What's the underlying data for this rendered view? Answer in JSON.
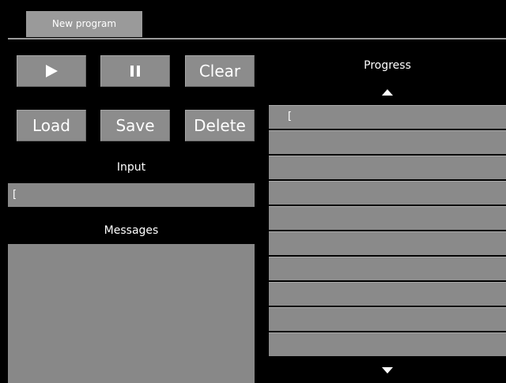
{
  "tab": {
    "label": "New program"
  },
  "buttons": {
    "play_icon": "play-icon",
    "pause_icon": "pause-icon",
    "clear": "Clear",
    "load": "Load",
    "save": "Save",
    "delete": "Delete"
  },
  "input": {
    "label": "Input",
    "value": "["
  },
  "messages": {
    "label": "Messages"
  },
  "progress": {
    "label": "Progress",
    "rows": [
      "[",
      "",
      "",
      "",
      "",
      "",
      "",
      "",
      "",
      ""
    ]
  },
  "colors": {
    "background": "#000000",
    "panel": "#888888",
    "button": "#8c8c8c"
  }
}
